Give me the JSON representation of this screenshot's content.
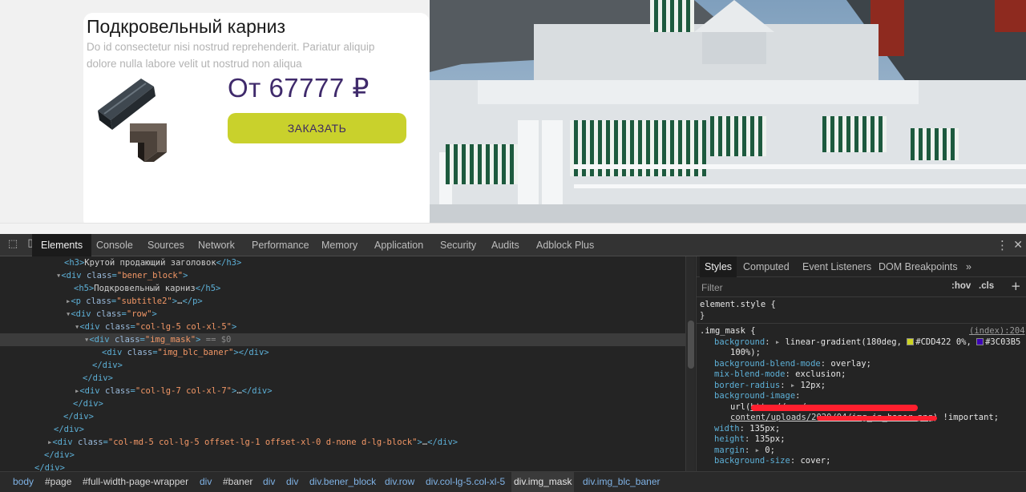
{
  "site": {
    "card_title": "Подкровельный карниз",
    "card_subtitle": "Do id consectetur nisi nostrud reprehenderit. Pariatur aliquip dolore nulla labore velit ut nostrud non aliqua",
    "price": "От 67777 ₽",
    "order_button": "ЗАКАЗАТЬ",
    "brand_colors": {
      "accent": "#C9D12C",
      "price": "#3F2A6B"
    }
  },
  "devtools": {
    "tabs": [
      "Elements",
      "Console",
      "Sources",
      "Network",
      "Performance",
      "Memory",
      "Application",
      "Security",
      "Audits",
      "Adblock Plus"
    ],
    "active_tab": "Elements",
    "styles_tabs": [
      "Styles",
      "Computed",
      "Event Listeners",
      "DOM Breakpoints",
      "»"
    ],
    "filter_placeholder": "Filter",
    "hov": ":hov",
    "cls": ".cls",
    "dom_lines": [
      "<h3>Крутой продающий заголовок</h3>",
      "<div class=\"bener_block\">",
      "<h5>Подкровельный карниз</h5>",
      "<p class=\"subtitle2\">…</p>",
      "<div class=\"row\">",
      "<div class=\"col-lg-5 col-xl-5\">",
      "<div class=\"img_mask\"> == $0",
      "<div class=\"img_blc_baner\"></div>",
      "</div>",
      "</div>",
      "<div class=\"col-lg-7 col-xl-7\">…</div>",
      "</div>",
      "</div>",
      "</div>",
      "<div class=\"col-md-5 col-lg-5 offset-lg-1 offset-xl-0 d-none d-lg-block\">…</div>",
      "</div>",
      "</div>"
    ],
    "styles": {
      "element_style": "element.style {",
      "selector": ".img_mask {",
      "source": "(index):204",
      "rules": [
        {
          "prop": "background",
          "value": "linear-gradient(180deg, #CDD422 0%, #3C03B5 100%);"
        },
        {
          "prop": "background-blend-mode",
          "value": "overlay;"
        },
        {
          "prop": "mix-blend-mode",
          "value": "exclusion;"
        },
        {
          "prop": "border-radius",
          "value": "12px;"
        },
        {
          "prop": "background-image",
          "value": "url(http://…ru/wp-content/uploads/2020/04/img_in_baner.png) !important;"
        },
        {
          "prop": "width",
          "value": "135px;"
        },
        {
          "prop": "height",
          "value": "135px;"
        },
        {
          "prop": "margin",
          "value": "0;"
        },
        {
          "prop": "background-size",
          "value": "cover;"
        }
      ],
      "gradient_colors": [
        "#CDD422",
        "#3C03B5"
      ]
    },
    "breadcrumbs": [
      "body",
      "#page",
      "#full-width-page-wrapper",
      "div",
      "#baner",
      "div",
      "div",
      "div.bener_block",
      "div.row",
      "div.col-lg-5.col-xl-5",
      "div.img_mask",
      "div.img_blc_baner"
    ]
  }
}
